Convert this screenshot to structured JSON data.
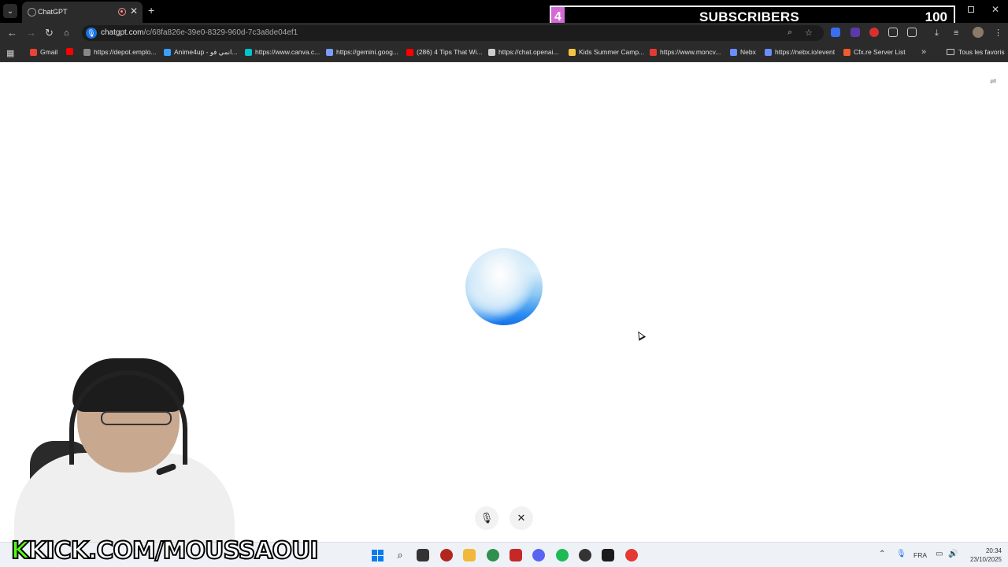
{
  "browser": {
    "tab_title": "ChatGPT",
    "url_host": "chatgpt.com",
    "url_path": "/c/68fa826e-39e0-8329-960d-7c3a8de04ef1"
  },
  "overlay": {
    "sub_count": "4",
    "sub_label": "SUBSCRIBERS",
    "sub_goal": "100"
  },
  "bookmarks": [
    {
      "label": "Gmail",
      "icon": "gmail-icon",
      "color": "#ea4335"
    },
    {
      "label": "",
      "icon": "youtube-icon",
      "color": "#ff0000"
    },
    {
      "label": "https://depot.emplo...",
      "icon": "globe-icon",
      "color": "#888888"
    },
    {
      "label": "Anime4up - انمي فو...",
      "icon": "anime4up-icon",
      "color": "#3aa0ff"
    },
    {
      "label": "https://www.canva.c...",
      "icon": "canva-icon",
      "color": "#00c4cc"
    },
    {
      "label": "https://gemini.goog...",
      "icon": "gemini-icon",
      "color": "#7b9cff"
    },
    {
      "label": "(286) 4 Tips That Wi...",
      "icon": "youtube-icon",
      "color": "#ff0000"
    },
    {
      "label": "https://chat.openai...",
      "icon": "openai-icon",
      "color": "#cccccc"
    },
    {
      "label": "Kids Summer Camp...",
      "icon": "camp-icon",
      "color": "#f4c542"
    },
    {
      "label": "https://www.moncv...",
      "icon": "moncv-icon",
      "color": "#e53935"
    },
    {
      "label": "Nebx",
      "icon": "nebx-icon",
      "color": "#6a8dff"
    },
    {
      "label": "https://nebx.io/event",
      "icon": "nebx-icon",
      "color": "#6a8dff"
    },
    {
      "label": "Cfx.re Server List",
      "icon": "cfx-icon",
      "color": "#f25b2a"
    }
  ],
  "all_bookmarks_label": "Tous les favoris",
  "stream": {
    "kick_prefix": "K",
    "kick_handle": "KICK.COM/MOUSSAOUI"
  },
  "taskbar": {
    "language": "FRA",
    "time": "20:34",
    "date": "23/10/2025"
  },
  "colors": {
    "accent": "#1a73e8",
    "kick_green": "#53fc18",
    "overlay_pink": "#d36ad6"
  }
}
